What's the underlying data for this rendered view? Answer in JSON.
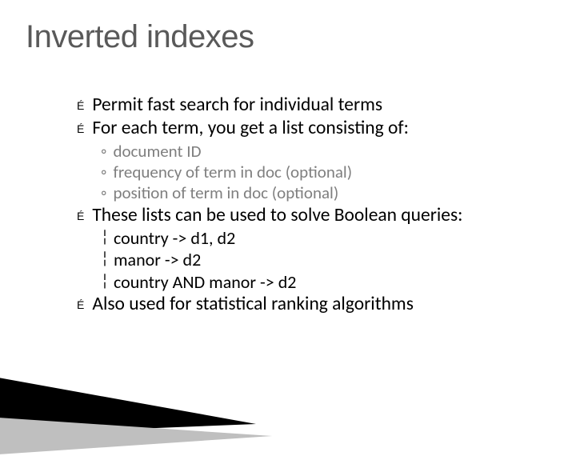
{
  "title": "Inverted indexes",
  "items": [
    {
      "level": 1,
      "text": "Permit fast search for individual terms"
    },
    {
      "level": 1,
      "text": "For each term, you get a list consisting of:"
    },
    {
      "level": 2,
      "text": "document ID"
    },
    {
      "level": 2,
      "text": "frequency of term in doc (optional)"
    },
    {
      "level": 2,
      "text": "position of term in doc    (optional)"
    },
    {
      "level": 1,
      "text": "These lists can be used to solve Boolean queries:"
    },
    {
      "level": 3,
      "text": "country -> d1, d2"
    },
    {
      "level": 3,
      "text": "manor -> d2"
    },
    {
      "level": 3,
      "text": "country AND manor -> d2"
    },
    {
      "level": 1,
      "text": "Also used for statistical ranking algorithms"
    }
  ]
}
